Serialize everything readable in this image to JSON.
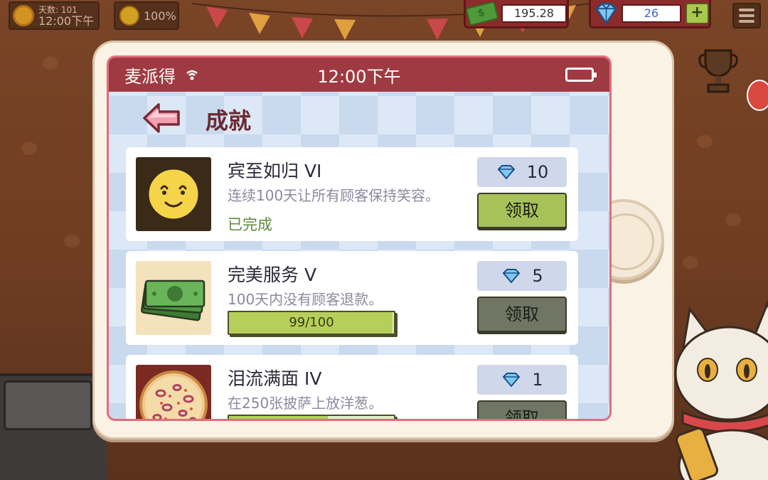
{
  "hud": {
    "days_label": "天数: 101",
    "time_label": "12:00下午",
    "mood_percent": "100%",
    "money": "195.28",
    "gems": "26",
    "add_label": "+"
  },
  "phone": {
    "carrier": "麦派得",
    "clock": "12:00下午"
  },
  "page": {
    "title": "成就"
  },
  "achievements": [
    {
      "name": "宾至如归  VI",
      "description": "连续100天让所有顾客保持笑容。",
      "status": "已完成",
      "reward": "10",
      "claim_label": "领取",
      "claimable": true
    },
    {
      "name": "完美服务  V",
      "description": "100天内没有顾客退款。",
      "progress_text": "99/100",
      "progress_fraction": 0.99,
      "reward": "5",
      "claim_label": "领取",
      "claimable": false
    },
    {
      "name": "泪流满面  IV",
      "description": "在250张披萨上放洋葱。",
      "progress_fraction": 0.6,
      "reward": "1",
      "claim_label": "领取",
      "claimable": false
    }
  ],
  "colors": {
    "statusbar": "#a03a42",
    "claim_active": "#a8c25a",
    "claim_inactive": "#707564",
    "title": "#6b2a30"
  }
}
